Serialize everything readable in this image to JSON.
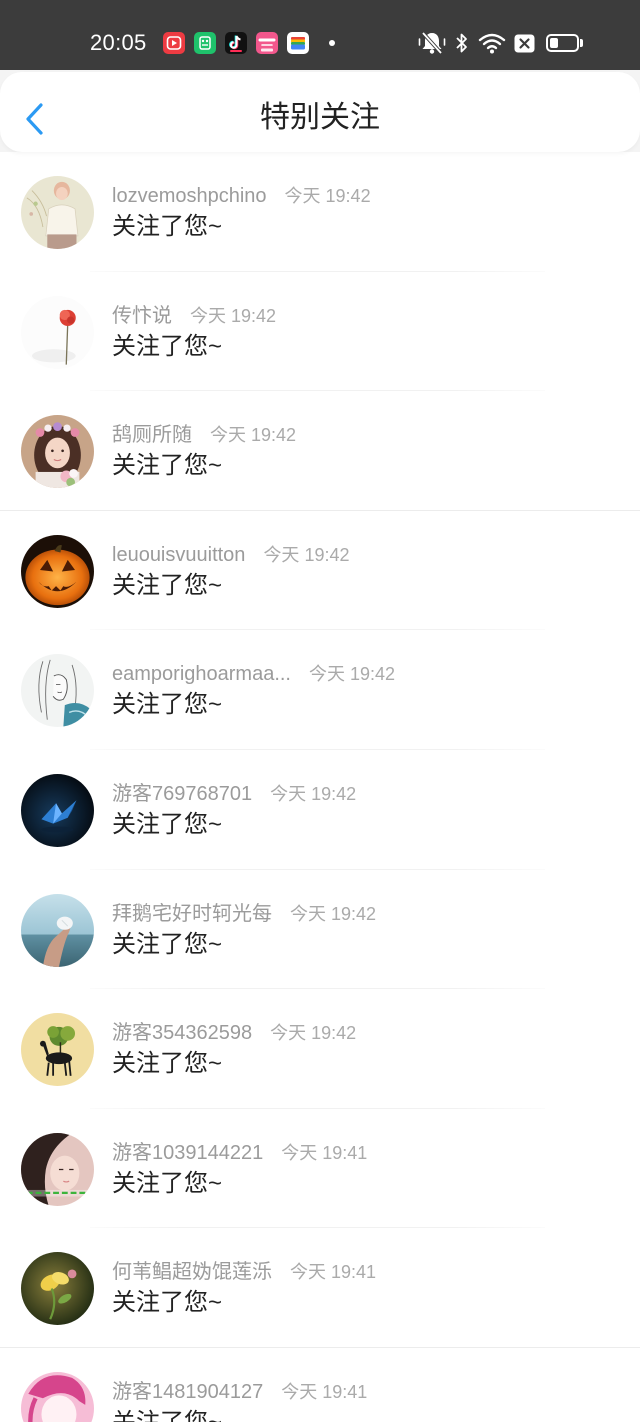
{
  "statusbar": {
    "time": "20:05",
    "notification_icons": [
      "video-app-icon",
      "green-app-icon",
      "tiktok-icon",
      "pink-app-icon",
      "wallet-app-icon",
      "more-notifications-dot"
    ],
    "system_icons": [
      "mute-icon",
      "bluetooth-icon",
      "wifi-icon",
      "close-box-icon",
      "battery-icon"
    ],
    "battery_level": 0.3
  },
  "header": {
    "back_icon": "chevron-left-icon",
    "title": "特别关注"
  },
  "theme": {
    "accent": "#2b9af3",
    "statusbar_bg": "#3c3c3c",
    "page_bg": "#f4f4f4",
    "name_color": "#9b9b9b",
    "time_color": "#aaaaaa",
    "message_color": "#222222"
  },
  "list": {
    "items": [
      {
        "name": "lozvemoshpchino",
        "time": "今天 19:42",
        "message": "关注了您~"
      },
      {
        "name": "传忭说",
        "time": "今天 19:42",
        "message": "关注了您~"
      },
      {
        "name": "鸹厕所随",
        "time": "今天 19:42",
        "message": "关注了您~"
      },
      {
        "name": "leuouisvuuitton",
        "time": "今天 19:42",
        "message": "关注了您~"
      },
      {
        "name": "eamporighoarmaa...",
        "time": "今天 19:42",
        "message": "关注了您~"
      },
      {
        "name": "游客769768701",
        "time": "今天 19:42",
        "message": "关注了您~"
      },
      {
        "name": "拜鹅宅好时轲光每",
        "time": "今天 19:42",
        "message": "关注了您~"
      },
      {
        "name": "游客354362598",
        "time": "今天 19:42",
        "message": "关注了您~"
      },
      {
        "name": "游客1039144221",
        "time": "今天 19:41",
        "message": "关注了您~"
      },
      {
        "name": "何苇鲳超妫馄莲泺",
        "time": "今天 19:41",
        "message": "关注了您~"
      },
      {
        "name": "游客1481904127",
        "time": "今天 19:41",
        "message": "关注了您~"
      }
    ]
  }
}
